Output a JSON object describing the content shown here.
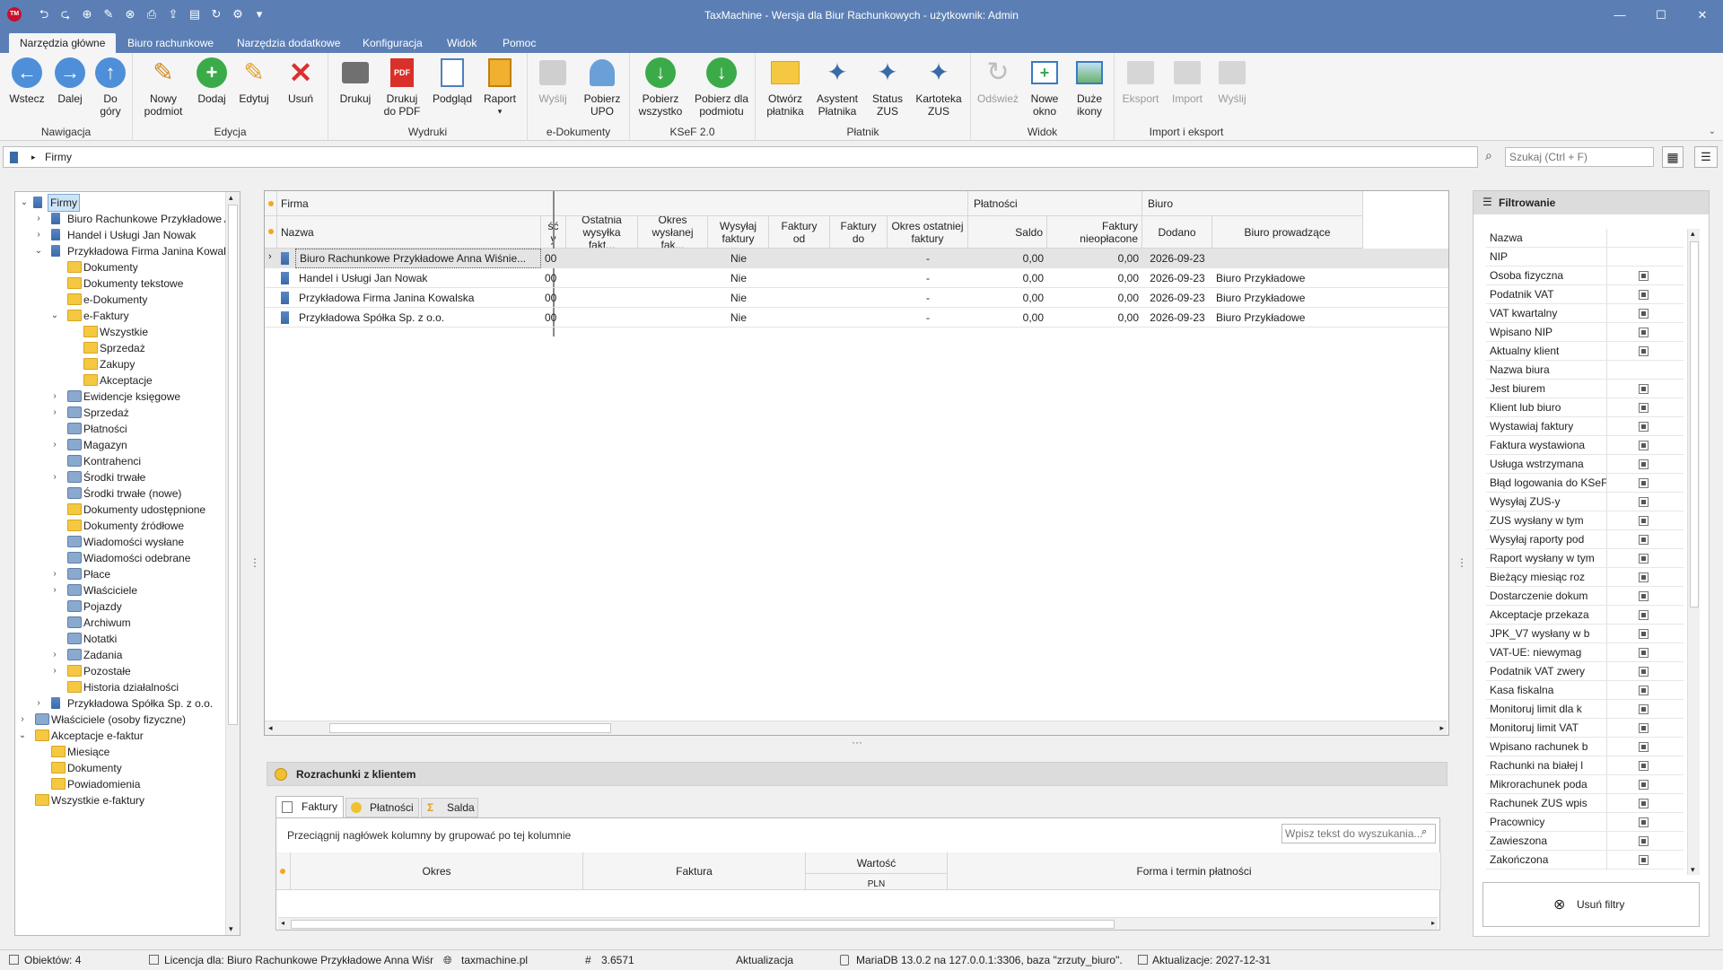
{
  "app": {
    "title": "TaxMachine  -  Wersja dla Biur Rachunkowych - użytkownik: Admin",
    "logo": "TM"
  },
  "menu_tabs": [
    "Narzędzia główne",
    "Biuro rachunkowe",
    "Narzędzia dodatkowe",
    "Konfiguracja",
    "Widok",
    "Pomoc"
  ],
  "ribbon": {
    "groups": {
      "nav": "Nawigacja",
      "edit": "Edycja",
      "print": "Wydruki",
      "edoc": "e-Dokumenty",
      "ksef": "KSeF 2.0",
      "payer": "Płatnik",
      "view": "Widok",
      "io": "Import i eksport"
    },
    "buttons": {
      "back": "Wstecz",
      "forward": "Dalej",
      "up1": "Do",
      "up2": "góry",
      "new1": "Nowy",
      "new2": "podmiot",
      "add": "Dodaj",
      "edit": "Edytuj",
      "delete": "Usuń",
      "print": "Drukuj",
      "pdf1": "Drukuj",
      "pdf2": "do PDF",
      "preview": "Podgląd",
      "report": "Raport",
      "send": "Wyślij",
      "upo1": "Pobierz",
      "upo2": "UPO",
      "getall1": "Pobierz",
      "getall2": "wszystko",
      "getsub1": "Pobierz dla",
      "getsub2": "podmiotu",
      "openpayer1": "Otwórz",
      "openpayer2": "płatnika",
      "assist1": "Asystent",
      "assist2": "Płatnika",
      "zus1": "Status",
      "zus2": "ZUS",
      "card1": "Kartoteka",
      "card2": "ZUS",
      "refresh": "Odśwież",
      "newwin1": "Nowe",
      "newwin2": "okno",
      "bigicons1": "Duże",
      "bigicons2": "ikony",
      "export": "Eksport",
      "import": "Import",
      "send2": "Wyślij"
    }
  },
  "breadcrumb": "Firmy",
  "search_placeholder": "Szukaj (Ctrl + F)",
  "tree": [
    "Firmy",
    "Biuro Rachunkowe Przykładowe Anna Wiśniewska",
    "Handel i Usługi Jan Nowak",
    "Przykładowa Firma Janina Kowalska",
    "Dokumenty",
    "Dokumenty tekstowe",
    "e-Dokumenty",
    "e-Faktury",
    "Wszystkie",
    "Sprzedaż",
    "Zakupy",
    "Akceptacje",
    "Ewidencje księgowe",
    "Sprzedaż",
    "Płatności",
    "Magazyn",
    "Kontrahenci",
    "Środki trwałe",
    "Środki trwałe (nowe)",
    "Dokumenty udostępnione",
    "Dokumenty źródłowe",
    "Wiadomości wysłane",
    "Wiadomości odebrane",
    "Płace",
    "Właściciele",
    "Pojazdy",
    "Archiwum",
    "Notatki",
    "Zadania",
    "Pozostałe",
    "Historia działalności",
    "Przykładowa Spółka Sp. z o.o.",
    "Właściciele (osoby fizyczne)",
    "Akceptacje e-faktur",
    "Miesiące",
    "Dokumenty",
    "Powiadomienia",
    "Wszystkie e-faktury"
  ],
  "grid": {
    "groups": [
      "Firma",
      "Płatności",
      "Biuro"
    ],
    "columns": [
      "Nazwa",
      "ść\ny",
      "Ostatnia\nwysyłka fakt...",
      "Okres\nwysłanej fak...",
      "Wysyłaj\nfaktury",
      "Faktury\nod",
      "Faktury\ndo",
      "Okres ostatniej\nfaktury",
      "Saldo",
      "Faktury\nnieopłacone",
      "Dodano",
      "Biuro prowadzące"
    ],
    "rows": [
      [
        "Biuro Rachunkowe Przykładowe Anna Wiśnie...",
        "00",
        "",
        "",
        "Nie",
        "",
        "",
        "-",
        "0,00",
        "0,00",
        "2026-09-23",
        ""
      ],
      [
        "Handel i Usługi Jan Nowak",
        "00",
        "",
        "",
        "Nie",
        "",
        "",
        "-",
        "0,00",
        "0,00",
        "2026-09-23",
        "Biuro Przykładowe"
      ],
      [
        "Przykładowa Firma Janina Kowalska",
        "00",
        "",
        "",
        "Nie",
        "",
        "",
        "-",
        "0,00",
        "0,00",
        "2026-09-23",
        "Biuro Przykładowe"
      ],
      [
        "Przykładowa Spółka Sp. z o.o.",
        "00",
        "",
        "",
        "Nie",
        "",
        "",
        "-",
        "0,00",
        "0,00",
        "2026-09-23",
        "Biuro Przykładowe"
      ]
    ]
  },
  "bottom": {
    "title": "Rozrachunki z klientem",
    "tabs": [
      "Faktury",
      "Płatności",
      "Salda"
    ],
    "group_hint": "Przeciągnij nagłówek kolumny by grupować po tej kolumnie",
    "search_placeholder": "Wpisz tekst do wyszukania...",
    "columns": [
      "Okres",
      "Faktura",
      "Wartość",
      "Forma i termin płatności"
    ],
    "sub": "PLN"
  },
  "filter": {
    "title": "Filtrowanie",
    "items": [
      "Nazwa",
      "NIP",
      "Osoba fizyczna",
      "Podatnik VAT",
      "VAT kwartalny",
      "Wpisano NIP",
      "Aktualny klient",
      "Nazwa biura",
      "Jest biurem",
      "Klient lub biuro",
      "Wystawiaj faktury",
      "Faktura wystawiona",
      "Usługa wstrzymana",
      "Błąd logowania do KSeF",
      "Wysyłaj ZUS-y",
      "ZUS wysłany w tym",
      "Wysyłaj raporty pod",
      "Raport wysłany w tym",
      "Bieżący miesiąc roz",
      "Dostarczenie dokum",
      "Akceptacje przekaza",
      "JPK_V7 wysłany w b",
      "VAT-UE: niewymag",
      "Podatnik VAT zwery",
      "Kasa fiskalna",
      "Monitoruj limit dla k",
      "Monitoruj limit VAT",
      "Wpisano rachunek b",
      "Rachunki na białej l",
      "Mikrorachunek poda",
      "Rachunek ZUS wpis",
      "Pracownicy",
      "Zawieszona",
      "Zakończona"
    ],
    "clear_button": "Usuń filtry"
  },
  "status": {
    "objects": "Obiektów: 4",
    "license": "Licencja dla: Biuro Rachunkowe Przykładowe Anna Wiśniewska",
    "site": "taxmachine.pl",
    "version": "3.6571",
    "update": "Aktualizacja",
    "db": "MariaDB 13.0.2 na 127.0.0.1:3306, baza \"zrzuty_biuro\".",
    "updates_until": "Aktualizacje: 2027-12-31"
  }
}
